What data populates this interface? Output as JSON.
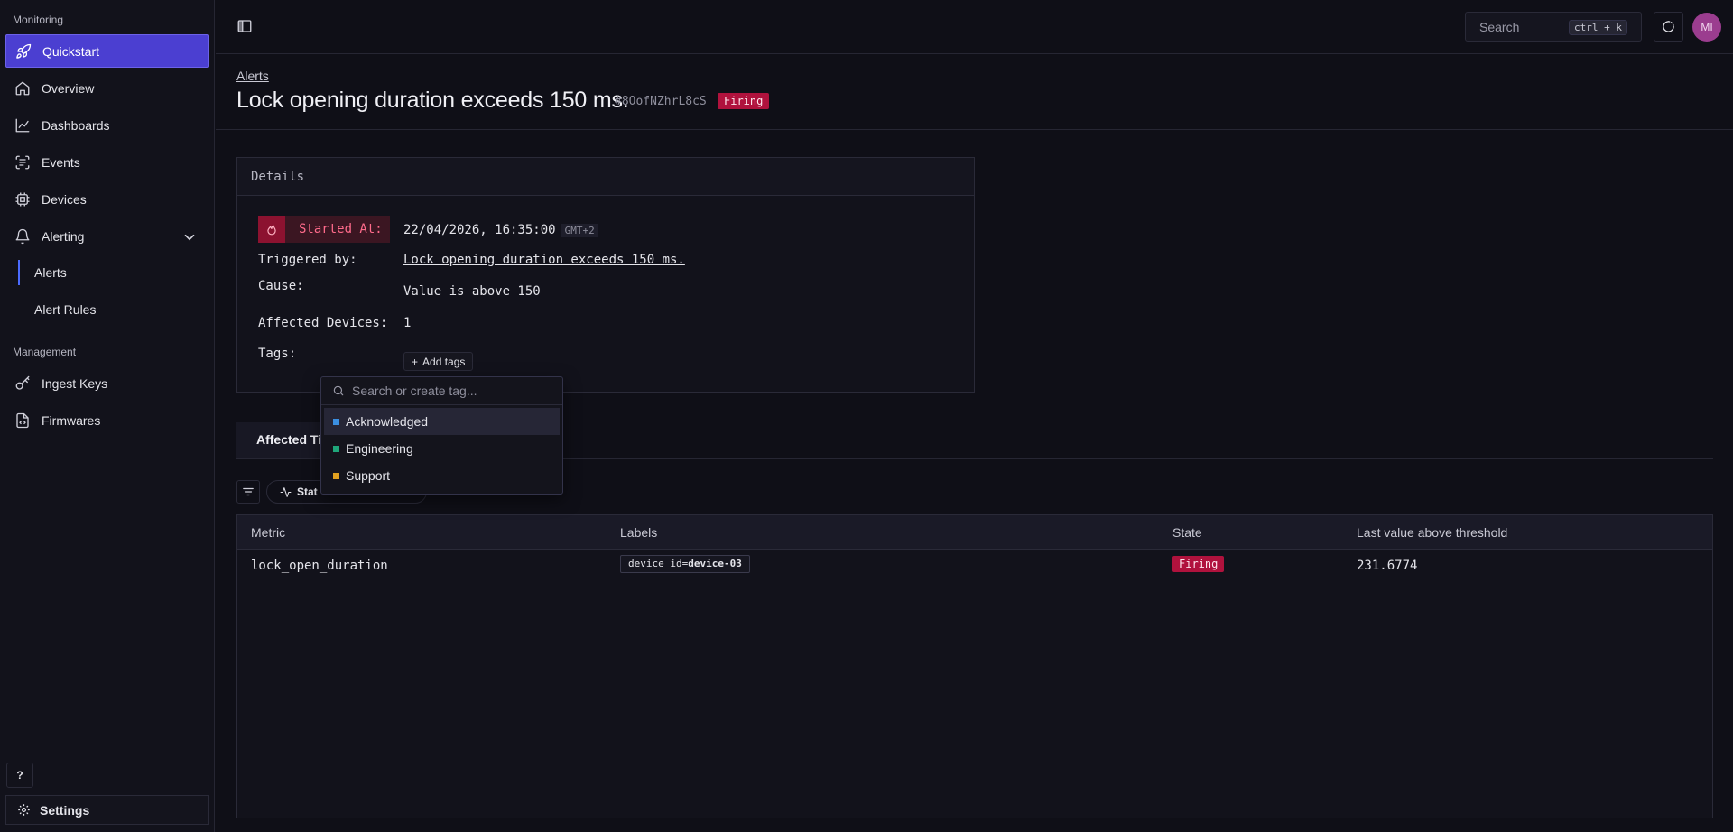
{
  "sidebar": {
    "section_monitoring": "Monitoring",
    "section_management": "Management",
    "items": {
      "quickstart": "Quickstart",
      "overview": "Overview",
      "dashboards": "Dashboards",
      "events": "Events",
      "devices": "Devices",
      "alerting": "Alerting",
      "alerts": "Alerts",
      "alert_rules": "Alert Rules",
      "ingest_keys": "Ingest Keys",
      "firmwares": "Firmwares"
    },
    "help_label": "?",
    "settings_label": "Settings"
  },
  "topbar": {
    "search_placeholder": "Search",
    "search_shortcut": "ctrl + k",
    "avatar_initials": "MI"
  },
  "header": {
    "breadcrumb": "Alerts",
    "title": "Lock opening duration exceeds 150 ms.",
    "alert_id": "#8OofNZhrL8cS",
    "status": "Firing"
  },
  "details": {
    "heading": "Details",
    "started_label": "Started At:",
    "started_value": "22/04/2026, 16:35:00",
    "timezone": "GMT+2",
    "triggered_label": "Triggered by:",
    "triggered_value": "Lock opening duration exceeds 150 ms.",
    "cause_label": "Cause:",
    "cause_value": "Value is above 150",
    "affected_label": "Affected Devices:",
    "affected_value": "1",
    "tags_label": "Tags:",
    "add_tags": "Add tags"
  },
  "tabs": {
    "active": "Affected Ti"
  },
  "toolbar": {
    "chip_label": "Stat"
  },
  "tag_dropdown": {
    "placeholder": "Search or create tag...",
    "options": [
      {
        "label": "Acknowledged",
        "color": "#3b8fe0"
      },
      {
        "label": "Engineering",
        "color": "#1fa67a"
      },
      {
        "label": "Support",
        "color": "#e0a020"
      }
    ]
  },
  "table": {
    "headers": [
      "Metric",
      "Labels",
      "State",
      "Last value above threshold"
    ],
    "rows": [
      {
        "metric": "lock_open_duration",
        "label_key": "device_id=",
        "label_value": "device-03",
        "state": "Firing",
        "last_value": "231.6774"
      }
    ]
  },
  "colors": {
    "accent": "#4b3fd1",
    "firing": "#b0123d",
    "background": "#0f0f17"
  }
}
